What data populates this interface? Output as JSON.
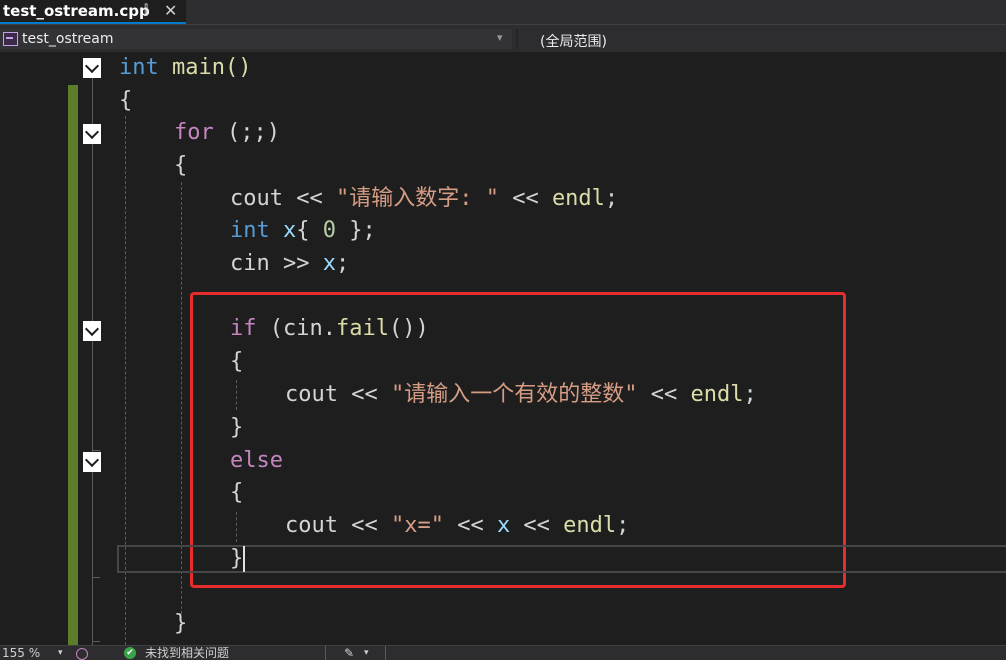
{
  "tab": {
    "title": "test_ostream.cpp",
    "pin_glyph": "⫿",
    "close_glyph": "✕"
  },
  "navbar": {
    "project": "test_ostream",
    "scope": "(全局范围)",
    "dropdown_glyph": "▾"
  },
  "code": {
    "l1": {
      "kw": "int",
      "rest": " main()"
    },
    "l2": "{",
    "l3": {
      "kw": "for",
      "rest": " (;;)"
    },
    "l4": "{",
    "l5": {
      "a": "cout << ",
      "s": "\"请输入数字: \"",
      "b": " << ",
      "e": "endl",
      "c": ";"
    },
    "l6": {
      "kw": "int",
      "v": " x",
      "a": "{ ",
      "n": "0",
      "b": " };"
    },
    "l7": {
      "a": "cin >> ",
      "v": "x",
      "b": ";"
    },
    "l9": {
      "kw": "if",
      "a": " (cin.",
      "f": "fail",
      "b": "())"
    },
    "l10": "{",
    "l11": {
      "a": "cout << ",
      "s": "\"请输入一个有效的整数\"",
      "b": " << ",
      "e": "endl",
      "c": ";"
    },
    "l12": "}",
    "l13": {
      "kw": "else"
    },
    "l14": "{",
    "l15": {
      "a": "cout << ",
      "s": "\"x=\"",
      "b": " << ",
      "v": "x",
      "c": " << ",
      "e": "endl",
      "d": ";"
    },
    "l16": "}",
    "l18": "}"
  },
  "statusbar": {
    "zoom": "155 %",
    "issues": "未找到相关问题",
    "ok_glyph": "✔",
    "brush_glyph": "✎"
  },
  "colors": {
    "keyword": "#569cd6",
    "control": "#c586c0",
    "function": "#dcdcaa",
    "string": "#d69d85",
    "variable": "#9cdcfe",
    "number": "#b5cea8",
    "highlight_box": "#e52d2d",
    "change_bar": "#5e7d2a"
  }
}
